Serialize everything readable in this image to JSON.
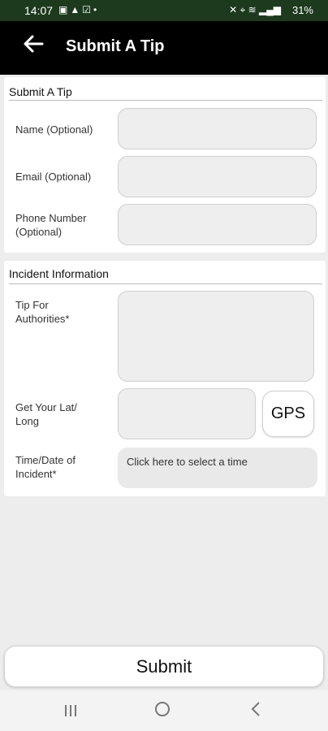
{
  "status_bar": {
    "time": "14:07",
    "notification_icons": [
      "image-icon",
      "alert-icon",
      "checkbox-icon",
      "dot-icon"
    ],
    "system_icons": [
      "mute-icon",
      "location-icon",
      "wifi-icon",
      "signal-icon"
    ],
    "battery": "31%"
  },
  "app_bar": {
    "back_icon": "arrow-left-icon",
    "title": "Submit A Tip"
  },
  "submit_section": {
    "title": "Submit A Tip",
    "name_label": "Name (Optional)",
    "name_value": "",
    "email_label": "Email (Optional)",
    "email_value": "",
    "phone_label": "Phone Number (Optional)",
    "phone_value": ""
  },
  "incident_section": {
    "title": "Incident Information",
    "tip_label": "Tip For Authorities*",
    "tip_value": "",
    "latlong_label": "Get Your Lat/ Long",
    "latlong_value": "",
    "gps_label": "GPS",
    "time_label": "Time/Date of Incident*",
    "time_placeholder": "Click here to select a time"
  },
  "submit_label": "Submit",
  "nav_bar": {
    "recents_icon": "recents-icon",
    "home_icon": "home-icon",
    "back_icon": "back-chevron-icon"
  }
}
